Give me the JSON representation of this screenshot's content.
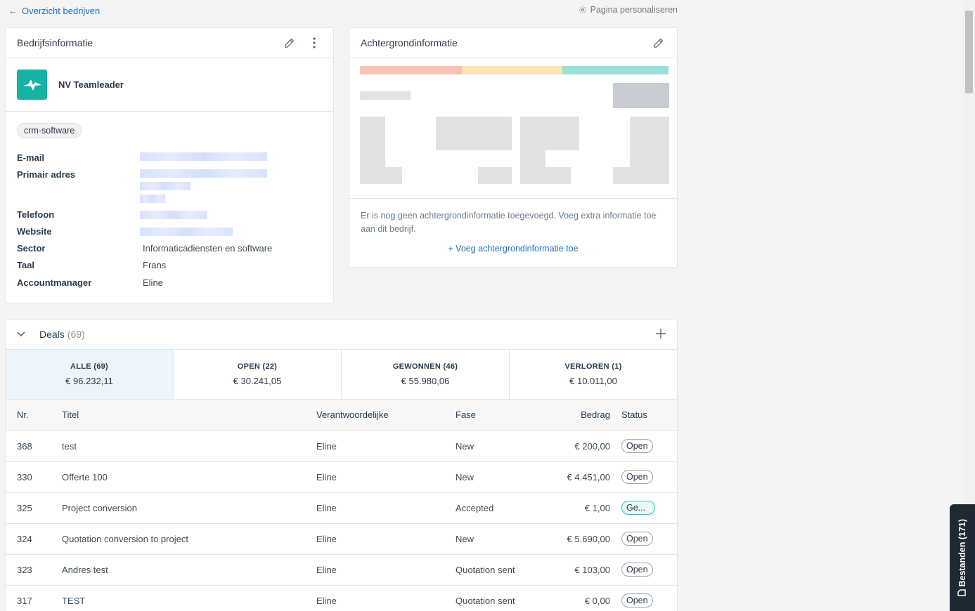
{
  "nav": {
    "back_label": "Overzicht bedrijven",
    "personalize_label": "Pagina personaliseren"
  },
  "company_card": {
    "title": "Bedrijfsinformatie",
    "company_name": "NV Teamleader",
    "tag": "crm-software",
    "fields": {
      "email_label": "E-mail",
      "address_label": "Primair adres",
      "phone_label": "Telefoon",
      "website_label": "Website",
      "sector_label": "Sector",
      "sector_value": "Informaticadiensten en software",
      "language_label": "Taal",
      "language_value": "Frans",
      "manager_label": "Accountmanager",
      "manager_value": "Eline"
    }
  },
  "background_card": {
    "title": "Achtergrondinformatie",
    "empty_text": "Er is nog geen achtergrondinformatie toegevoegd. Voeg extra informatie toe aan dit bedrijf.",
    "add_label": "Voeg achtergrondinformatie toe",
    "colors": [
      "#f9c2b4",
      "#fde4b2",
      "#9adfd9"
    ]
  },
  "deals": {
    "title": "Deals",
    "count": "(69)",
    "tabs": [
      {
        "label": "ALLE (69)",
        "value": "€ 96.232,11"
      },
      {
        "label": "OPEN (22)",
        "value": "€ 30.241,05"
      },
      {
        "label": "GEWONNEN (46)",
        "value": "€ 55.980,06"
      },
      {
        "label": "VERLOREN (1)",
        "value": "€ 10.011,00"
      }
    ],
    "columns": {
      "nr": "Nr.",
      "title": "Titel",
      "responsible": "Verantwoordelijke",
      "phase": "Fase",
      "amount": "Bedrag",
      "status": "Status"
    },
    "rows": [
      {
        "nr": "368",
        "title": "test",
        "responsible": "Eline",
        "phase": "New",
        "amount": "€ 200,00",
        "status": "Open"
      },
      {
        "nr": "330",
        "title": "Offerte 100",
        "responsible": "Eline",
        "phase": "New",
        "amount": "€ 4.451,00",
        "status": "Open"
      },
      {
        "nr": "325",
        "title": "Project conversion",
        "responsible": "Eline",
        "phase": "Accepted",
        "amount": "€ 1,00",
        "status": "Ge..."
      },
      {
        "nr": "324",
        "title": "Quotation conversion to project",
        "responsible": "Eline",
        "phase": "New",
        "amount": "€ 5.690,00",
        "status": "Open"
      },
      {
        "nr": "323",
        "title": "Andres test",
        "responsible": "Eline",
        "phase": "Quotation sent",
        "amount": "€ 103,00",
        "status": "Open"
      },
      {
        "nr": "317",
        "title": "TEST",
        "responsible": "Eline",
        "phase": "Quotation sent",
        "amount": "€ 0,00",
        "status": "Open"
      }
    ]
  },
  "files_tab": {
    "label": "Bestanden (171)"
  }
}
